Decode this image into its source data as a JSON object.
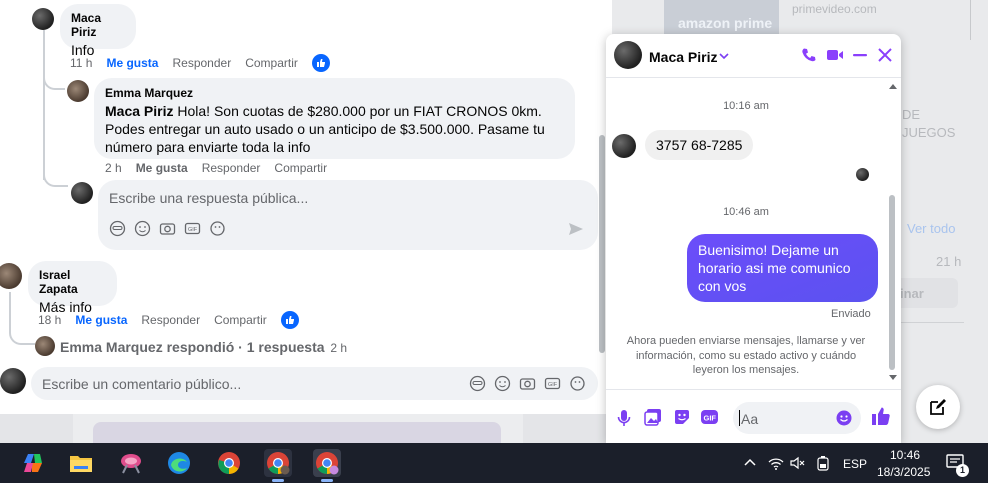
{
  "comments": {
    "c1": {
      "author": "Maca Piriz",
      "text": "Info",
      "time": "11 h",
      "like": "Me gusta",
      "reply": "Responder",
      "share": "Compartir"
    },
    "reply1": {
      "author": "Emma Marquez",
      "mention": "Maca Piriz",
      "text": " Hola! Son cuotas de $280.000 por un FIAT CRONOS 0km. Podes entregar un auto usado o un anticipo de $3.500.000. Pasame tu número para enviarte toda la info",
      "time": "2 h",
      "like": "Me gusta",
      "reply": "Responder",
      "share": "Compartir"
    },
    "reply_input": {
      "placeholder": "Escribe una respuesta pública..."
    },
    "c2": {
      "author": "Israel Zapata",
      "text": "Más info",
      "time": "18 h",
      "like": "Me gusta",
      "reply": "Responder",
      "share": "Compartir"
    },
    "replies_summary": {
      "text": "Emma Marquez respondió · 1 respuesta",
      "time": "2 h"
    },
    "comment_input": {
      "placeholder": "Escribe un comentario público..."
    }
  },
  "background": {
    "amazon_label": "amazon prime",
    "site": "primevideo.com",
    "text_de": "DE",
    "text_juegos": "JUEGOS",
    "ver_todo": "Ver todo",
    "time": "21 h",
    "btn": "inar"
  },
  "messenger": {
    "contact": "Maca Piriz",
    "timestamp1": "10:16 am",
    "incoming": "3757 68-7285",
    "timestamp2": "10:46 am",
    "outgoing": "Buenisimo! Dejame un horario asi me comunico con vos",
    "status": "Enviado",
    "info": "Ahora pueden enviarse mensajes, llamarse y ver información, como su estado activo y cuándo leyeron los mensajes.",
    "input_placeholder": "Aa",
    "accent": "#7b3ff2"
  },
  "taskbar": {
    "language": "ESP",
    "time": "10:46",
    "date": "18/3/2025",
    "notifications": "1"
  }
}
